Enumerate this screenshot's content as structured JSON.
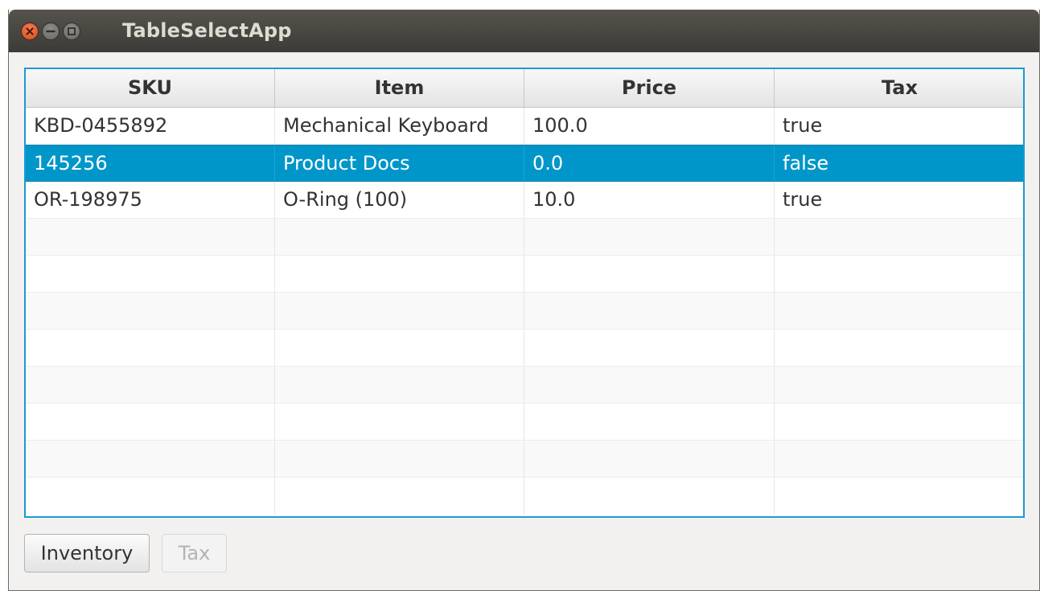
{
  "window": {
    "title": "TableSelectApp"
  },
  "table": {
    "columns": [
      "SKU",
      "Item",
      "Price",
      "Tax"
    ],
    "rows": [
      [
        "KBD-0455892",
        "Mechanical Keyboard",
        "100.0",
        "true"
      ],
      [
        "145256",
        "Product Docs",
        "0.0",
        "false"
      ],
      [
        "OR-198975",
        "O-Ring (100)",
        "10.0",
        "true"
      ]
    ],
    "selected_row_index": 1
  },
  "buttons": {
    "inventory_label": "Inventory",
    "tax_label": "Tax"
  },
  "colors": {
    "selection": "#0096c9",
    "focus_border": "#1a9bd1",
    "close_button": "#e9541e"
  },
  "icons": {
    "close": "close-icon",
    "minimize": "minimize-icon",
    "maximize": "maximize-icon"
  }
}
